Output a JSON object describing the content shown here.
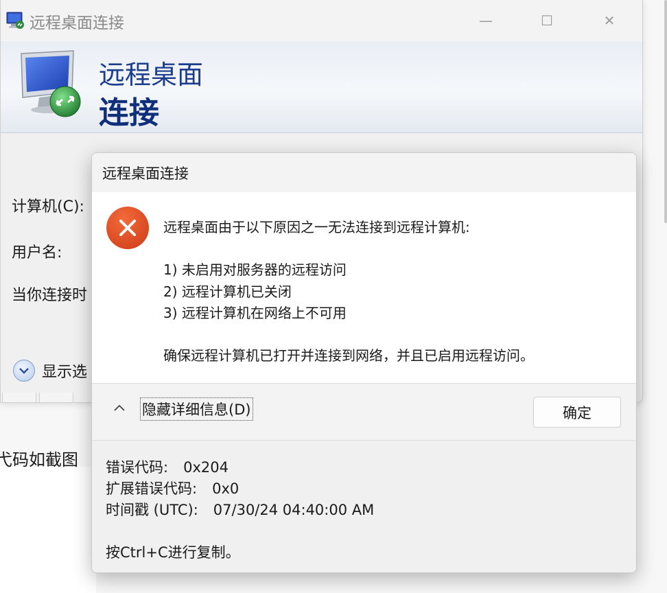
{
  "window": {
    "title": "远程桌面连接",
    "banner_line1": "远程桌面",
    "banner_line2": "连接",
    "controls": {
      "minimize": "—",
      "maximize": "☐",
      "close": "✕"
    }
  },
  "form": {
    "computer_label": "计算机(C):",
    "user_label": "用户名:",
    "connect_hint": "当你连接时",
    "show_options": "显示选"
  },
  "background": {
    "snippet_text": "弋码如截图"
  },
  "dialog": {
    "title": "远程桌面连接",
    "message": "远程桌面由于以下原因之一无法连接到远程计算机:",
    "reasons": [
      "1) 未启用对服务器的远程访问",
      "2) 远程计算机已关闭",
      "3) 远程计算机在网络上不可用"
    ],
    "ensure": "确保远程计算机已打开并连接到网络，并且已启用远程访问。",
    "hide_details": "隐藏详细信息(D)",
    "ok": "确定",
    "details": {
      "error_code_label": "错误代码:",
      "error_code": "0x204",
      "ext_error_code_label": "扩展错误代码:",
      "ext_error_code": "0x0",
      "timestamp_label": "时间戳 (UTC):",
      "timestamp": "07/30/24 04:40:00 AM",
      "copy_hint": "按Ctrl+C进行复制。"
    }
  },
  "colors": {
    "banner_text": "#1c3c8c",
    "error_red": "#e4572e",
    "dialog_bg": "#ffffff",
    "panel_bg": "#f3f3f3"
  },
  "icons": {
    "app": "remote-desktop-icon",
    "error": "error-x-icon",
    "chevron": "chevron-up-icon",
    "options": "chevron-down-circle-icon"
  }
}
